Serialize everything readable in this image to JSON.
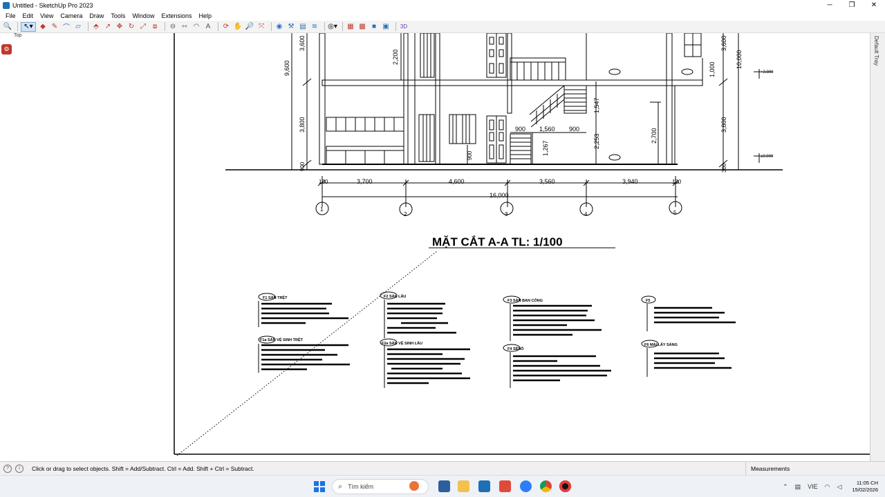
{
  "window": {
    "title": "Untitled - SketchUp Pro 2023",
    "controls": [
      "─",
      "❐",
      "✕"
    ]
  },
  "menu": [
    "File",
    "Edit",
    "View",
    "Camera",
    "Draw",
    "Tools",
    "Window",
    "Extensions",
    "Help"
  ],
  "scene_label": "Top",
  "tray_label": "Default Tray",
  "drawing": {
    "title": "MẶT CẮT A-A TL: 1/100",
    "dims_vertical_left": [
      "3,600",
      "9,600",
      "2,200",
      "3,800",
      "900"
    ],
    "dims_vertical_right": [
      "3,600",
      "10,000",
      "1,000",
      "3,800",
      "300"
    ],
    "dims_inner": [
      "1,547",
      "2,253",
      "2,700",
      "1,267",
      "900"
    ],
    "dims_horizontal": [
      "100",
      "3,700",
      "4,600",
      "3,560",
      "3,940",
      "100"
    ],
    "dims_stair": [
      "900",
      "1,560",
      "900"
    ],
    "dim_total": "16,000",
    "grid_axes": [
      "1",
      "2",
      "3",
      "4",
      "5"
    ],
    "levels": [
      "+3.800",
      "±0.000"
    ],
    "notes": [
      {
        "label": "F1 SÀN TRỆT"
      },
      {
        "label": "F2 SÀN LẦU"
      },
      {
        "label": "F3 SÀN BAN CÔNG"
      },
      {
        "label": "F5"
      },
      {
        "label": "F1a SÀN VỆ SINH TRỆT"
      },
      {
        "label": "F2a SÀN VỆ SINH LẦU"
      },
      {
        "label": "F4 SÊNÔ"
      },
      {
        "label": "F6 MÁI LẤY SÁNG"
      }
    ]
  },
  "status": {
    "hint": "Click or drag to select objects. Shift = Add/Subtract. Ctrl = Add. Shift + Ctrl = Subtract.",
    "measurements_label": "Measurements"
  },
  "taskbar": {
    "search_placeholder": "Tìm kiếm",
    "lang": "VIE",
    "time": "11:05 CH",
    "date": "15/02/2026"
  },
  "icons": [
    "search-icon",
    "select-arrow-icon",
    "eraser-icon",
    "pencil-icon",
    "shape-icon",
    "push-pull-icon",
    "move-icon",
    "rotate-icon",
    "scale-icon",
    "offset-icon",
    "tape-icon",
    "orbit-icon",
    "pan-icon",
    "zoom-icon",
    "zoom-extents-icon",
    "warehouse-icon",
    "extension-icon"
  ]
}
